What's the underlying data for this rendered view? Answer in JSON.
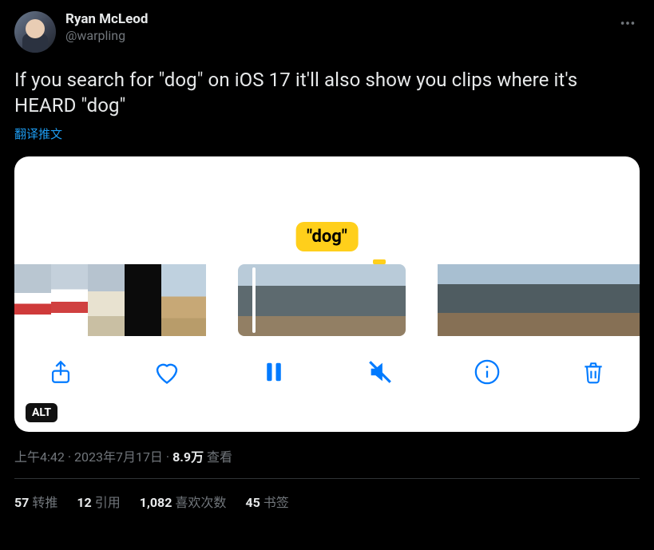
{
  "author": {
    "display_name": "Ryan McLeod",
    "handle": "@warpling"
  },
  "tweet_text": "If you search for \"dog\" on iOS 17 it'll also show you clips where it's HEARD \"dog\"",
  "translate_label": "翻译推文",
  "media": {
    "tag_text": "\"dog\"",
    "alt_badge": "ALT"
  },
  "meta": {
    "time": "上午4:42",
    "date": "2023年7月17日",
    "views_number": "8.9万",
    "views_label": "查看"
  },
  "stats": {
    "retweets": {
      "count": "57",
      "label": "转推"
    },
    "quotes": {
      "count": "12",
      "label": "引用"
    },
    "likes": {
      "count": "1,082",
      "label": "喜欢次数"
    },
    "bookmarks": {
      "count": "45",
      "label": "书签"
    }
  }
}
